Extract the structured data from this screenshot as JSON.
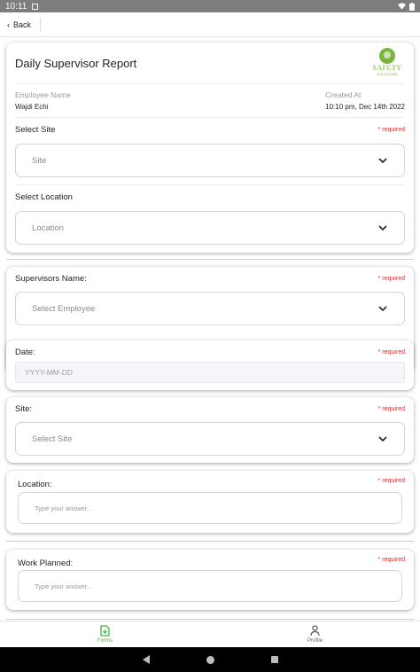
{
  "status_bar": {
    "time": "10:11"
  },
  "header": {
    "back_label": "Back"
  },
  "report": {
    "title": "Daily Supervisor Report",
    "logo_text": "SAFETY",
    "logo_subtext": "SOLUTIONS",
    "employee_label": "Employee Name",
    "employee_value": "Wajdi Echi",
    "created_label": "Created At",
    "created_value": "10:10 pm, Dec 14th 2022",
    "site_label": "Select Site",
    "site_placeholder": "Site",
    "location_label": "Select Location",
    "location_placeholder": "Location"
  },
  "required_text": "* required",
  "fields": {
    "supervisor_label": "Supervisors Name:",
    "supervisor_placeholder": "Select Employee",
    "date_label": "Date:",
    "date_placeholder": "YYYY-MM-DD",
    "site_label": "Site:",
    "site_placeholder": "Select Site",
    "location_label": "Location:",
    "location_placeholder": "Type your answer...",
    "work_label": "Work Planned:",
    "work_placeholder": "Type your answer..."
  },
  "bottom_nav": {
    "forms_label": "Forms",
    "profile_label": "Profile"
  },
  "colors": {
    "accent": "#4caf50",
    "required": "#d32f2f",
    "logo": "#7cb342"
  }
}
